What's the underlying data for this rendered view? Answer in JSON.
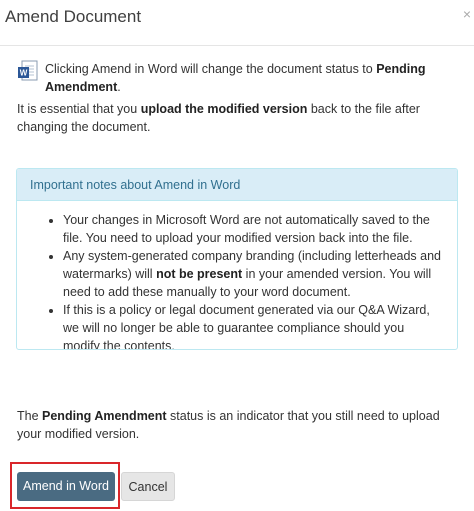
{
  "dialog": {
    "title": "Amend Document",
    "close_glyph": "×"
  },
  "intro": {
    "line_start": "Clicking Amend in Word will change the document status to ",
    "status_bold": "Pending Amendment",
    "line_end": ".",
    "icon": "word-document-icon"
  },
  "essential": {
    "start": "It is essential that you ",
    "bold": "upload the modified version",
    "end": " back to the file after changing the document."
  },
  "notes": {
    "heading": "Important notes about Amend in Word",
    "item1": "Your changes in Microsoft Word are not automatically saved to the file. You need to upload your modified version back into the file.",
    "item2_start": "Any system-generated company branding (including letterheads and watermarks) will ",
    "item2_bold": "not be present",
    "item2_end": " in your amended version. You will need to add these manually to your word document.",
    "item3": "If this is a policy or legal document generated via our Q&A Wizard, we will no longer be able to guarantee compliance should you modify the contents."
  },
  "footer_note": {
    "start": "The ",
    "bold": "Pending Amendment",
    "end": " status is an indicator that you still need to upload your modified version."
  },
  "buttons": {
    "primary": "Amend in Word",
    "cancel": "Cancel"
  },
  "colors": {
    "primary_button": "#4a6b82",
    "info_background": "#d9edf7",
    "info_text": "#31708f",
    "highlight": "#d9262a"
  }
}
